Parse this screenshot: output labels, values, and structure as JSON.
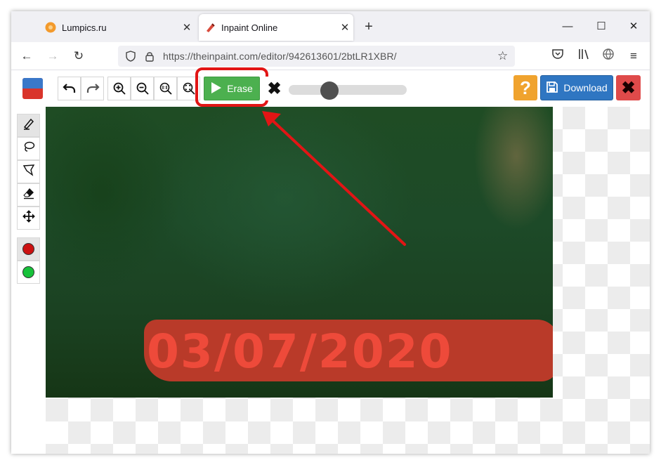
{
  "browser": {
    "tabs": [
      {
        "title": "Lumpics.ru",
        "active": false,
        "icon": "orange-circle-favicon"
      },
      {
        "title": "Inpaint Online",
        "active": true,
        "icon": "pencil-favicon"
      }
    ],
    "new_tab_symbol": "+",
    "url": "https://theinpaint.com/editor/942613601/2btLR1XBR/"
  },
  "toolbar": {
    "erase_label": "Erase",
    "download_label": "Download",
    "help_symbol": "?",
    "close_symbol": "✖",
    "clear_symbol": "✖",
    "brush_size_fraction": 0.32
  },
  "photo": {
    "overlay_text": "03/07/2020"
  },
  "colors": {
    "erase_green": "#4cb04f",
    "download_blue": "#2f76c2",
    "help_orange": "#f0a32e",
    "close_red": "#df4a4a",
    "highlight_red": "#e21515",
    "marker_red": "#cc1111",
    "marker_green": "#17c23a"
  }
}
